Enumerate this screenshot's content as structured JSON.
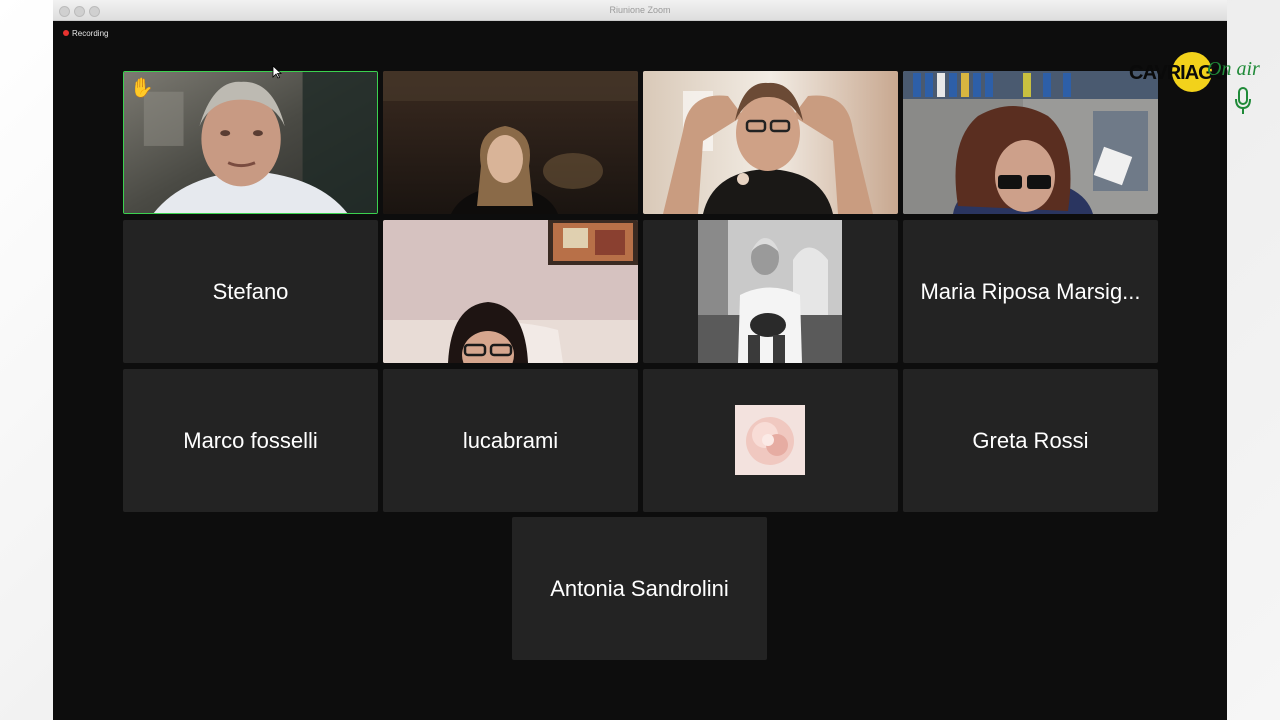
{
  "window": {
    "title": "Riunione Zoom"
  },
  "recording": {
    "label": "Recording",
    "color": "#e8322f"
  },
  "logo": {
    "text": "CAVRIAGO",
    "subtext": "On air",
    "icon": "microphone-icon"
  },
  "participants": [
    {
      "id": "p1",
      "type": "video",
      "active": true,
      "hand_raised": true,
      "icon": "hand-raised-icon"
    },
    {
      "id": "p2",
      "type": "video"
    },
    {
      "id": "p3",
      "type": "video"
    },
    {
      "id": "p4",
      "type": "video"
    },
    {
      "id": "p5",
      "type": "name",
      "name": "Stefano"
    },
    {
      "id": "p6",
      "type": "video"
    },
    {
      "id": "p7",
      "type": "profile-photo"
    },
    {
      "id": "p8",
      "type": "name",
      "name": "Maria Riposa Marsig..."
    },
    {
      "id": "p9",
      "type": "name",
      "name": "Marco fosselli"
    },
    {
      "id": "p10",
      "type": "name",
      "name": "lucabrami"
    },
    {
      "id": "p11",
      "type": "profile-photo"
    },
    {
      "id": "p12",
      "type": "name",
      "name": "Greta Rossi"
    },
    {
      "id": "p13",
      "type": "name",
      "name": "Antonia Sandrolini"
    }
  ],
  "colors": {
    "tile_background": "#232323",
    "active_speaker_border": "#3bd14f",
    "window_background": "#0d0d0d"
  }
}
